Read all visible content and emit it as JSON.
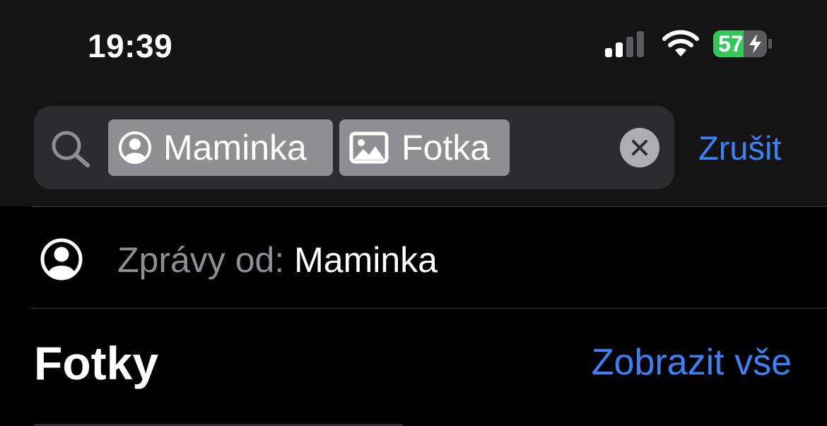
{
  "status_bar": {
    "time": "19:39",
    "battery_level": "57",
    "icons": [
      "cellular-signal-icon",
      "wifi-icon",
      "battery-charging-icon"
    ],
    "battery_color": "#34c759"
  },
  "search": {
    "tokens": [
      {
        "icon": "person-circle-icon",
        "label": "Maminka"
      },
      {
        "icon": "photo-icon",
        "label": "Fotka"
      }
    ],
    "cancel_label": "Zrušit",
    "icon": "search-icon"
  },
  "suggestion": {
    "icon": "person-circle-icon",
    "prefix": "Zprávy od: ",
    "value": "Maminka"
  },
  "section": {
    "title": "Fotky",
    "see_all_label": "Zobrazit vše"
  },
  "colors": {
    "accent": "#3b82f6",
    "background": "#000000",
    "header_background": "#141414",
    "search_field": "#2c2c2e",
    "token": "#8e8e93"
  }
}
